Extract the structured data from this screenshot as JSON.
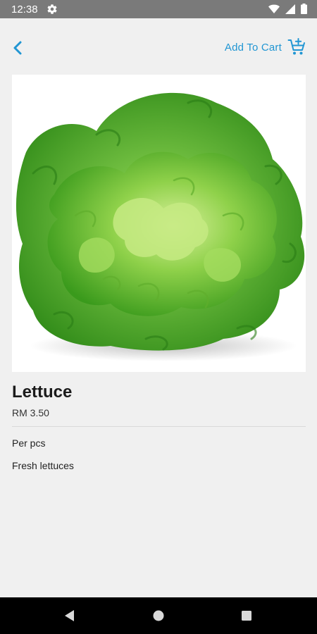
{
  "status_bar": {
    "time": "12:38",
    "icons": [
      "gear-icon",
      "wifi-icon",
      "cellular-icon",
      "battery-icon"
    ]
  },
  "app_bar": {
    "back_icon": "chevron-left-icon",
    "add_to_cart_label": "Add To Cart",
    "cart_icon": "cart-add-icon"
  },
  "product": {
    "image": "lettuce-photo",
    "name": "Lettuce",
    "price": "RM 3.50",
    "unit": "Per pcs",
    "description": "Fresh lettuces"
  },
  "nav_bar": {
    "icons": [
      "nav-back-icon",
      "nav-home-icon",
      "nav-recents-icon"
    ]
  },
  "colors": {
    "accent": "#2196d3",
    "background": "#f0f0f0",
    "status_bar": "#7a7a7a",
    "nav_bar": "#000000"
  }
}
